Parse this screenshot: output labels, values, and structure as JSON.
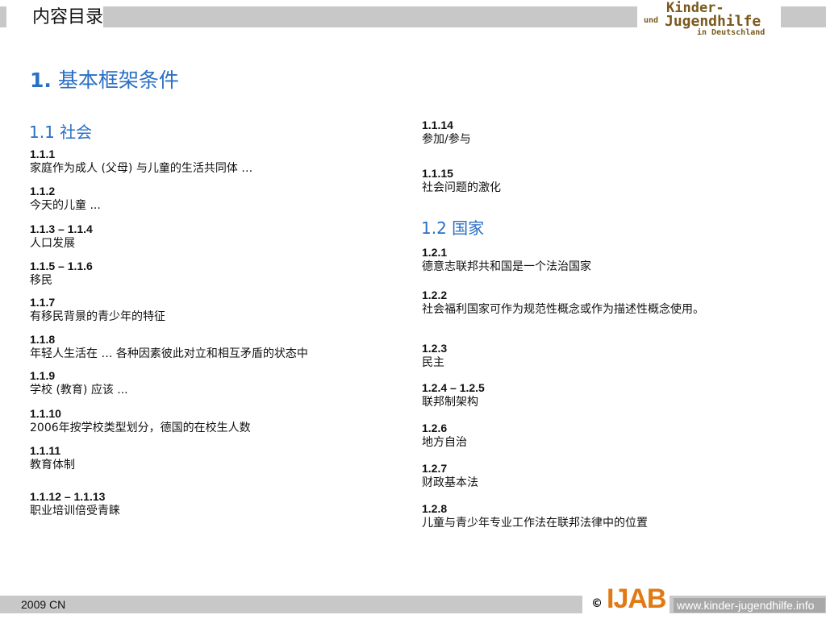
{
  "header": {
    "title": "内容目录",
    "logo": {
      "line1": "Kinder-",
      "und": "und",
      "line2": "Jugendhilfe",
      "line3": "in Deutschland"
    }
  },
  "section": {
    "number": "1.",
    "title": "基本框架条件"
  },
  "left_column": {
    "heading": "1.1 社会",
    "entries": [
      {
        "code": "1.1.1",
        "text": "家庭作为成人 (父母) 与儿童的生活共同体 …"
      },
      {
        "code": "1.1.2",
        "text": "今天的儿童 ..."
      },
      {
        "code": "1.1.3 – 1.1.4",
        "text": "人口发展"
      },
      {
        "code": "1.1.5 – 1.1.6",
        "text": "移民"
      },
      {
        "code": "1.1.7",
        "text": "有移民背景的青少年的特征"
      },
      {
        "code": "1.1.8",
        "text": "年轻人生活在 … 各种因素彼此对立和相互矛盾的状态中"
      },
      {
        "code": "1.1.9",
        "text": "学校 (教育) 应该 ..."
      },
      {
        "code": "1.1.10",
        "text": "2006年按学校类型划分，德国的在校生人数"
      },
      {
        "code": "1.1.11",
        "text": "教育体制"
      },
      {
        "code": "1.1.12 – 1.1.13",
        "text": "职业培训倍受青睐"
      }
    ]
  },
  "right_column": {
    "entries_top": [
      {
        "code": "1.1.14",
        "text": "参加/参与"
      },
      {
        "code": "1.1.15",
        "text": "社会问题的激化"
      }
    ],
    "heading": "1.2 国家",
    "entries": [
      {
        "code": "1.2.1",
        "text": "德意志联邦共和国是一个法治国家"
      },
      {
        "code": "1.2.2",
        "text": "社会福利国家可作为规范性概念或作为描述性概念使用。"
      },
      {
        "code": "1.2.3",
        "text": "民主"
      },
      {
        "code": "1.2.4 – 1.2.5",
        "text": "联邦制架构"
      },
      {
        "code": "1.2.6",
        "text": "地方自治"
      },
      {
        "code": "1.2.7",
        "text": "财政基本法"
      },
      {
        "code": "1.2.8",
        "text": "儿童与青少年专业工作法在联邦法律中的位置"
      }
    ]
  },
  "footer": {
    "left": "2009 CN",
    "copyright": "©",
    "brand": "IJAB",
    "url": "www.kinder-jugendhilfe.info"
  },
  "colors": {
    "accent": "#2a6fc4",
    "band": "#c8c8c8",
    "brand": "#e07a14",
    "logo": "#7a5a1e"
  }
}
